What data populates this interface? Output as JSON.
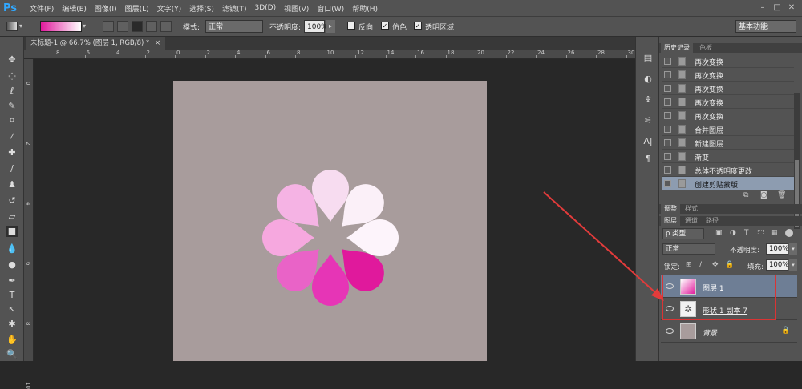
{
  "app": {
    "logo": "Ps"
  },
  "menubar": {
    "items": [
      "文件(F)",
      "编辑(E)",
      "图像(I)",
      "图层(L)",
      "文字(Y)",
      "选择(S)",
      "滤镜(T)",
      "3D(D)",
      "视图(V)",
      "窗口(W)",
      "帮助(H)"
    ],
    "min": "–",
    "restore": "□",
    "close": "✕"
  },
  "options": {
    "mode_label": "模式:",
    "mode_value": "正常",
    "opacity_label": "不透明度:",
    "opacity_value": "100%",
    "reverse_label": "反向",
    "dither_label": "仿色",
    "transparency_label": "透明区域",
    "workspace": "基本功能",
    "gradient_colors": [
      "#e0199c",
      "#ffffff"
    ]
  },
  "document": {
    "tab_title": "未标题-1 @ 66.7% (图层 1, RGB/8) *",
    "tab_close": "×",
    "background_color": "#a89c9c",
    "ruler_top": [
      "8",
      "6",
      "4",
      "2",
      "0",
      "2",
      "4",
      "6",
      "8",
      "10",
      "12",
      "14",
      "16",
      "18",
      "20",
      "22",
      "24",
      "26",
      "28",
      "30"
    ],
    "ruler_left": [
      "0",
      "2",
      "4",
      "6",
      "8",
      "10"
    ]
  },
  "flower": {
    "petal_colors": [
      "#f7dcf0",
      "#fbf0f8",
      "#fdf4fb",
      "#f5b3e4",
      "#f6a8df",
      "#e963c7",
      "#e0199c",
      "#e635b6"
    ]
  },
  "history": {
    "tabs": [
      "历史记录",
      "色板"
    ],
    "items": [
      {
        "label": "再次变换",
        "selected": false
      },
      {
        "label": "再次变换",
        "selected": false
      },
      {
        "label": "再次变换",
        "selected": false
      },
      {
        "label": "再次变换",
        "selected": false
      },
      {
        "label": "再次变换",
        "selected": false
      },
      {
        "label": "合并图层",
        "selected": false
      },
      {
        "label": "新建图层",
        "selected": false
      },
      {
        "label": "渐变",
        "selected": false
      },
      {
        "label": "总体不透明度更改",
        "selected": false
      },
      {
        "label": "创建剪贴蒙版",
        "selected": true
      }
    ]
  },
  "adjust": {
    "tabs": [
      "调整",
      "样式"
    ]
  },
  "layers": {
    "tabs": [
      "图层",
      "通道",
      "路径"
    ],
    "filter_label": "ρ 类型",
    "blend_mode": "正常",
    "opacity_label": "不透明度:",
    "opacity_value": "100%",
    "lock_label": "锁定:",
    "fill_label": "填充:",
    "fill_value": "100%",
    "rows": [
      {
        "name": "图层 1",
        "selected": true
      },
      {
        "name": "形状 1 副本 7",
        "selected": false
      },
      {
        "name": "背景",
        "selected": false
      }
    ]
  },
  "annotation": {
    "arrow_color": "#e23b3b"
  }
}
